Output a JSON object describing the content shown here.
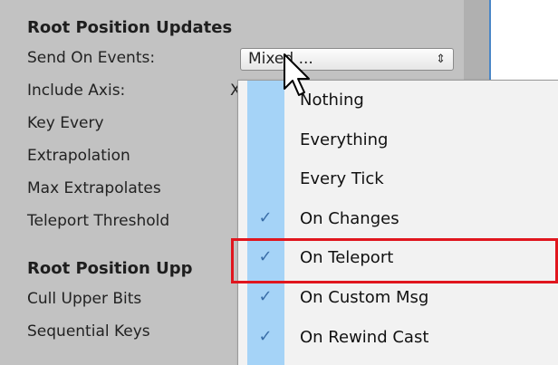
{
  "inspector": {
    "section1_title": "Root Position Updates",
    "labels": [
      "Send On Events:",
      "Include Axis:",
      "Key Every",
      "Extrapolation",
      "Max Extrapolates",
      "Teleport Threshold"
    ],
    "include_axis_fragment": "X",
    "section2_title": "Root Position Upp",
    "labels2": [
      "Cull Upper Bits",
      "Sequential Keys"
    ]
  },
  "dropdown": {
    "value": "Mixed ...",
    "arrows": "⇕"
  },
  "menu": {
    "items": [
      {
        "label": "Nothing",
        "checked": false
      },
      {
        "label": "Everything",
        "checked": false
      },
      {
        "label": "Every Tick",
        "checked": false
      },
      {
        "label": "On Changes",
        "checked": true
      },
      {
        "label": "On Teleport",
        "checked": true
      },
      {
        "label": "On Custom Msg",
        "checked": true
      },
      {
        "label": "On Rewind Cast",
        "checked": true
      }
    ],
    "check_glyph": "✓"
  },
  "colors": {
    "inspector_bg": "#c2c2c2",
    "check_column": "#a5d3f7",
    "highlight_box": "#e0161e",
    "menu_bg": "#f2f2f2"
  }
}
